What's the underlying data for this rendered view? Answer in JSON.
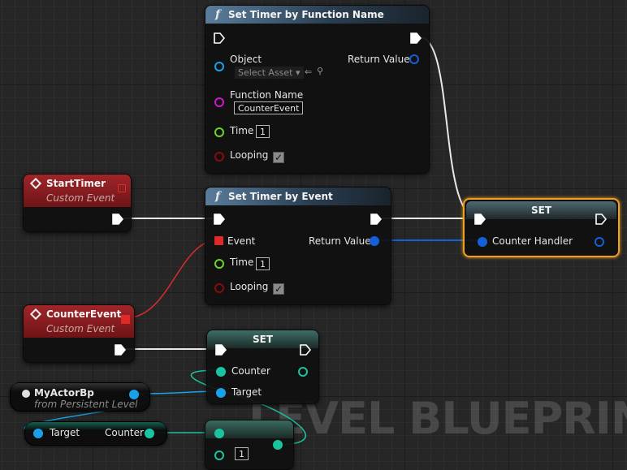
{
  "canvas": {
    "watermark": "LEVEL BLUEPRINT"
  },
  "colors": {
    "exec": "#ffffff",
    "object": "#1aa0e8",
    "name": "#d018c8",
    "int": "#6ed22a",
    "bool": "#8a0c0c",
    "event": "#e02a2a",
    "struct": "#1560d8",
    "teal": "#1ac4a0"
  },
  "nodes": {
    "set_timer_by_function_name": {
      "title": "Set Timer by Function Name",
      "object_label": "Object",
      "select_asset": "Select Asset",
      "return_value_label": "Return Value",
      "function_name_label": "Function Name",
      "function_name_value": "CounterEvent",
      "time_label": "Time",
      "time_value": "1",
      "looping_label": "Looping"
    },
    "start_timer": {
      "title": "StartTimer",
      "subtitle": "Custom Event"
    },
    "set_timer_by_event": {
      "title": "Set Timer by Event",
      "event_label": "Event",
      "return_value_label": "Return Value",
      "time_label": "Time",
      "time_value": "1",
      "looping_label": "Looping"
    },
    "set_counter_handler": {
      "title": "SET",
      "var_label": "Counter Handler"
    },
    "counter_event": {
      "title": "CounterEvent",
      "subtitle": "Custom Event"
    },
    "set_counter": {
      "title": "SET",
      "counter_label": "Counter",
      "target_label": "Target"
    },
    "my_actor_bp": {
      "title": "MyActorBp",
      "subtitle": "from Persistent Level"
    },
    "get_counter": {
      "target_label": "Target",
      "counter_label": "Counter"
    },
    "increment": {
      "value": "1"
    }
  }
}
